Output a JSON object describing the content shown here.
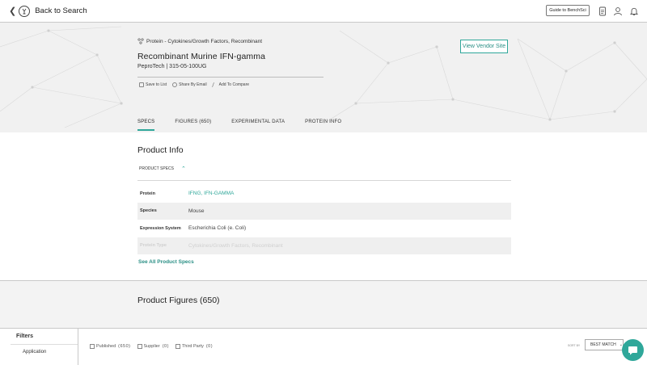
{
  "topbar": {
    "back_label": "Back to Search",
    "guide_label": "Guide to BenchSci",
    "icons": [
      "document-icon",
      "user-icon",
      "bell-icon"
    ]
  },
  "product": {
    "category": "Protein - Cytokines/Growth Factors, Recombinant",
    "title": "Recombinant Murine IFN-gamma",
    "vendor_line": "PeproTech | 315-05-100UG",
    "actions": [
      "Save to List",
      "Share By Email",
      "Add To Compare"
    ],
    "vendor_button": "View Vendor Site"
  },
  "tabs": [
    {
      "label": "SPECS",
      "active": true
    },
    {
      "label": "FIGURES (650)",
      "active": false
    },
    {
      "label": "EXPERIMENTAL DATA",
      "active": false
    },
    {
      "label": "PROTEIN INFO",
      "active": false
    }
  ],
  "product_info": {
    "title": "Product Info",
    "specs_toggle": "PRODUCT SPECS",
    "rows": [
      {
        "key": "Protein",
        "value": "IFNG, IFN-GAMMA"
      },
      {
        "key": "Species",
        "value": "Mouse"
      },
      {
        "key": "Expression System",
        "value": "Escherichia Coli (e. Coli)"
      },
      {
        "key": "Protein Type",
        "value": "Cytokines/Growth Factors, Recombinant"
      }
    ],
    "see_all": "See All Product Specs"
  },
  "figures": {
    "title": "Product Figures (650)"
  },
  "filters": {
    "title": "Filters",
    "application": "Application"
  },
  "chips": [
    {
      "label": "Published",
      "count": "(650)"
    },
    {
      "label": "Supplier",
      "count": "(0)"
    },
    {
      "label": "Third Party",
      "count": "(0)"
    }
  ],
  "sort": {
    "label": "SORT BY",
    "value": "BEST MATCH"
  },
  "colors": {
    "accent": "#2fa79a"
  }
}
